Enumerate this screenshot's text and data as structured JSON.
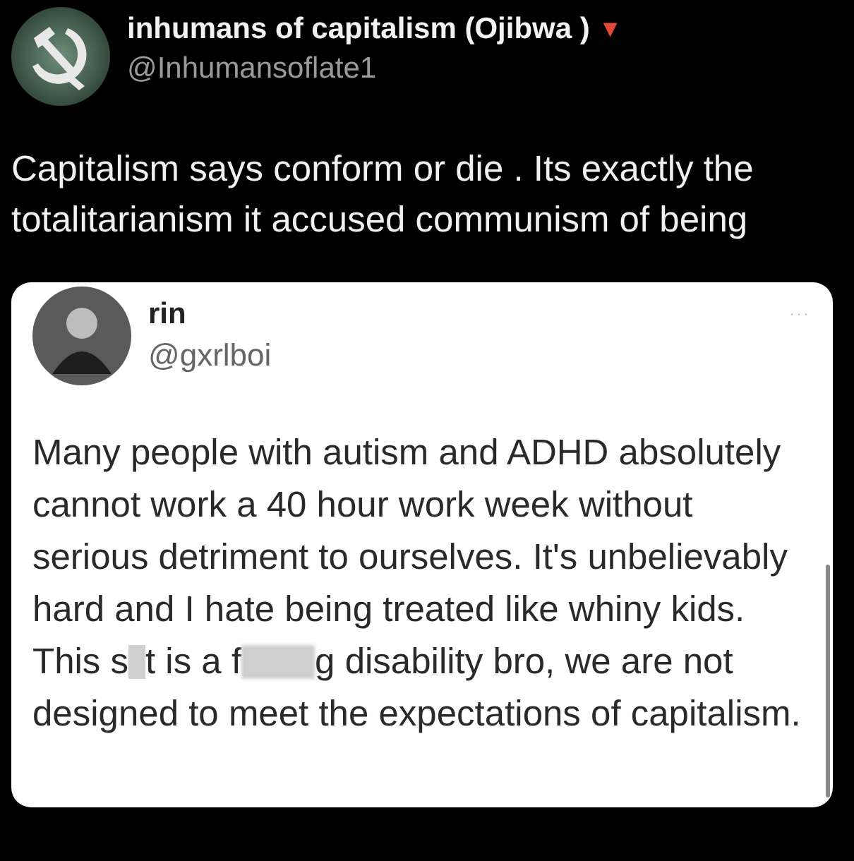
{
  "post": {
    "author": {
      "name": "inhumans of capitalism (Ojibwa )",
      "flag": "▼",
      "handle": "@Inhumansoflate1"
    },
    "text": "Capitalism says conform or die . Its exactly the totalitarianism  it accused communism of being",
    "quote": {
      "author": {
        "name": "rin",
        "handle": "@gxrlboi"
      },
      "menu": "···",
      "body": [
        {
          "kind": "text",
          "text": "Many people with autism and ADHD absolutely cannot work a 40 hour work week without serious detriment to ourselves. It's unbelievably hard and I hate being treated like whiny kids. This s"
        },
        {
          "kind": "mask"
        },
        {
          "kind": "text",
          "text": "t is a f"
        },
        {
          "kind": "blur"
        },
        {
          "kind": "text",
          "text": "g disability bro, we are not designed to meet the expectations of capitalism."
        }
      ]
    }
  }
}
